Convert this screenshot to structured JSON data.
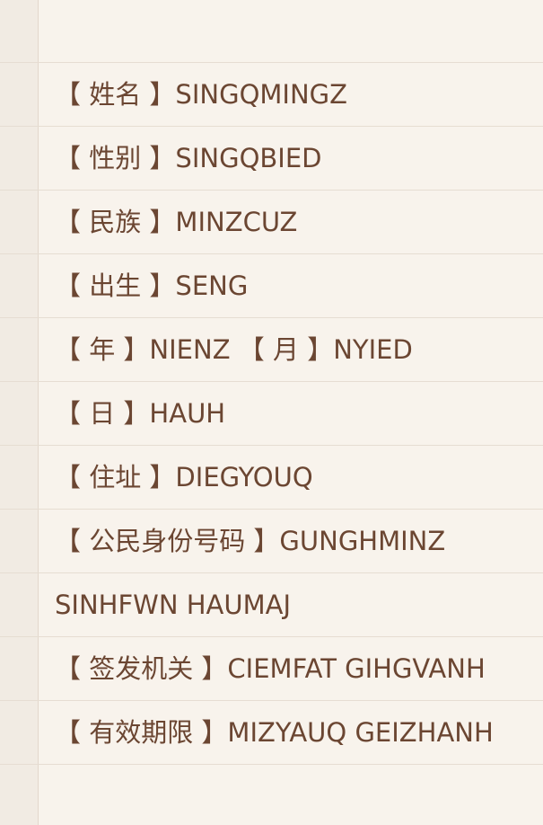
{
  "lines": [
    "【 姓名 】SINGQMINGZ",
    "【 性别 】SINGQBIED",
    "【 民族 】MINZCUZ",
    "【 出生 】SENG",
    "【 年 】NIENZ 【 月 】NYIED",
    "【 日 】HAUH",
    "【 住址 】DIEGYOUQ",
    "【 公民身份号码 】GUNGHMINZ",
    "SINHFWN HAUMAJ",
    "【 签发机关 】CIEMFAT GIHGVANH",
    "【 有效期限 】MIZYAUQ GEIZHANH"
  ],
  "colors": {
    "background": "#f8f3ec",
    "margin": "#f1ebe3",
    "rule": "#e6ddd2",
    "text": "#6b4632"
  }
}
